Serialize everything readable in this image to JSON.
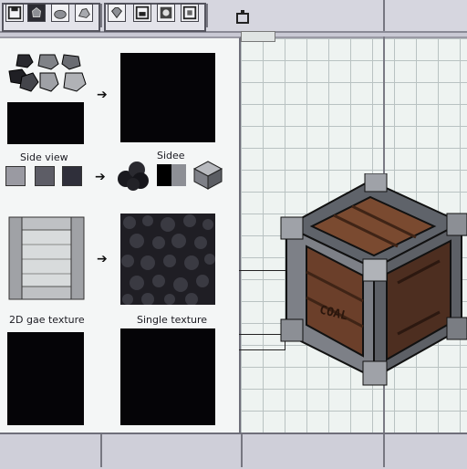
{
  "toolbar": {
    "tools": [
      {
        "icon": "save-icon"
      },
      {
        "icon": "stone-block-icon"
      },
      {
        "icon": "rock-icon"
      },
      {
        "icon": "rock-alt-icon"
      },
      {
        "icon": "gem-icon"
      },
      {
        "icon": "window-icon"
      },
      {
        "icon": "grid-icon"
      },
      {
        "icon": "frame-icon"
      }
    ],
    "right_icon": "box-tool-icon"
  },
  "left_panel": {
    "side_view_label": "Side view",
    "side_label": "Sidee",
    "texture_label": "2D gae texture",
    "single_texture_label": "Single texture",
    "swatch_colors": [
      "#9a9aa2",
      "#5d5d66",
      "#2f2f3a"
    ]
  },
  "preview": {
    "crate_label": "COAL"
  },
  "colors": {
    "stone": "#8d8f95",
    "wood": "#6b3f2a",
    "coal": "#1e1d24"
  }
}
